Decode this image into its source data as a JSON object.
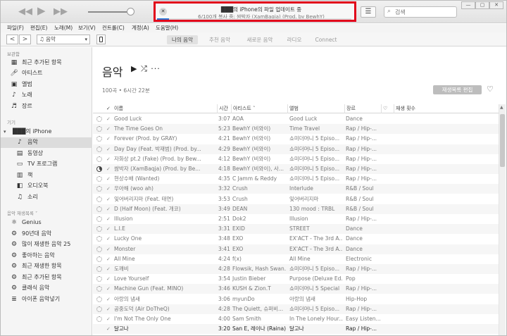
{
  "player": {
    "prev_icon": "rewind-icon",
    "play_icon": "play-icon",
    "next_icon": "fast-forward-icon",
    "volume": 0.88
  },
  "status": {
    "title": "███의 iPhone의 파일 업데이트 중",
    "subtitle": "6/100개 복사 중: 쌈박자 (XamBaqja) (Prod. by BewhY)",
    "close_glyph": "✕",
    "progress": 0.06,
    "highlight_color": "#e1001a"
  },
  "search": {
    "placeholder": "검색",
    "icon": "search-icon"
  },
  "window_controls": [
    "—",
    "▢",
    "✕"
  ],
  "menu": [
    "파일(F)",
    "편집(E)",
    "노래(M)",
    "보기(V)",
    "컨트롤(C)",
    "계정(A)",
    "도움말(H)"
  ],
  "nav": {
    "back": "<",
    "forward": ">",
    "library": "음악",
    "tabs": [
      "나의 음악",
      "추천 음악",
      "새로운 음악",
      "라디오",
      "Connect"
    ],
    "active_tab": "나의 음악"
  },
  "sidebar": {
    "library_header": "보관함",
    "library": [
      {
        "label": "최근 추가된 항목",
        "icon": "recent-grid-icon"
      },
      {
        "label": "아티스트",
        "icon": "microphone-icon"
      },
      {
        "label": "앨범",
        "icon": "album-icon"
      },
      {
        "label": "노래",
        "icon": "note-icon"
      },
      {
        "label": "장르",
        "icon": "genre-icon"
      }
    ],
    "devices_header": "기기",
    "device_name": "███의 iPhone",
    "device_items": [
      {
        "label": "음악",
        "icon": "note-icon"
      },
      {
        "label": "동영상",
        "icon": "film-icon"
      },
      {
        "label": "TV 프로그램",
        "icon": "tv-icon"
      },
      {
        "label": "책",
        "icon": "book-icon"
      },
      {
        "label": "오디오북",
        "icon": "audiobook-icon"
      },
      {
        "label": "소리",
        "icon": "bell-icon"
      }
    ],
    "playlists_header": "음악 재생목록 ˅",
    "playlists": [
      {
        "label": "Genius",
        "icon": "genius-icon"
      },
      {
        "label": "90년대 음악",
        "icon": "gear-icon"
      },
      {
        "label": "많이 재생한 음악 25",
        "icon": "gear-icon"
      },
      {
        "label": "좋아하는 음악",
        "icon": "gear-icon"
      },
      {
        "label": "최근 재생한 항목",
        "icon": "gear-icon"
      },
      {
        "label": "최근 추가된 항목",
        "icon": "gear-icon"
      },
      {
        "label": "클래식 음악",
        "icon": "gear-icon"
      },
      {
        "label": "아이폰 음악넣기",
        "icon": "playlist-icon"
      }
    ]
  },
  "main": {
    "title": "음악",
    "controls": "▶ ⤮ ···",
    "summary": "100곡 • 6시간 22분",
    "edit_button": "재생목록 편집",
    "heart_icon": "heart-icon"
  },
  "table": {
    "headers": {
      "check": "✓",
      "name": "이름",
      "time": "시간",
      "artist": "아티스트",
      "album": "앨범",
      "genre": "장르",
      "love": "♡",
      "plays": "재생 횟수"
    },
    "rows": [
      {
        "name": "Good Luck",
        "time": "3:07",
        "artist": "AOA",
        "album": "Good Luck",
        "genre": "Dance",
        "sync": "done"
      },
      {
        "name": "The Time Goes On",
        "time": "5:23",
        "artist": "BewhY (비와이)",
        "album": "Time Travel",
        "genre": "Rap / Hip-...",
        "sync": "done"
      },
      {
        "name": "Forever (Prod. by GRAY)",
        "time": "4:21",
        "artist": "BewhY (비와이)",
        "album": "쇼미더머니 5 Episo...",
        "genre": "Rap / Hip-...",
        "sync": "done"
      },
      {
        "name": "Day Day (Feat. 박재범) (Prod. by...",
        "time": "4:29",
        "artist": "BewhY (비와이)",
        "album": "쇼미더머니 5 Episo...",
        "genre": "Rap / Hip-...",
        "sync": "done"
      },
      {
        "name": "자화상 pt.2 (Fake) (Prod. by Bew...",
        "time": "4:12",
        "artist": "BewhY (비와이)",
        "album": "쇼미더머니 5 Episo...",
        "genre": "Rap / Hip-...",
        "sync": "done"
      },
      {
        "name": "쌈박자 (XamBaqja) (Prod. by Be...",
        "time": "4:18",
        "artist": "BewhY (비와이), 사...",
        "album": "쇼미더머니 5 Episo...",
        "genre": "Rap / Hip-...",
        "sync": "working"
      },
      {
        "name": "현상수배 (Wanted)",
        "time": "4:35",
        "artist": "C Jamm & Reddy",
        "album": "쇼미더머니 5 Episo...",
        "genre": "Rap / Hip-...",
        "sync": "done"
      },
      {
        "name": "우아해 (woo ah)",
        "time": "3:32",
        "artist": "Crush",
        "album": "Interlude",
        "genre": "R&B / Soul",
        "sync": "done"
      },
      {
        "name": "잊어버리지마 (Feat. 태연)",
        "time": "3:53",
        "artist": "Crush",
        "album": "잊어버리지마",
        "genre": "R&B / Soul",
        "sync": "done"
      },
      {
        "name": "D (Half Moon) (Feat. 개코)",
        "time": "3:49",
        "artist": "DEAN",
        "album": "130 mood : TRBL",
        "genre": "R&B / Soul",
        "sync": "done"
      },
      {
        "name": "Illusion",
        "time": "2:51",
        "artist": "Dok2",
        "album": "Illusion",
        "genre": "Rap / Hip-...",
        "sync": "done"
      },
      {
        "name": "L.I.E",
        "time": "3:31",
        "artist": "EXID",
        "album": "STREET",
        "genre": "Dance",
        "sync": "done"
      },
      {
        "name": "Lucky One",
        "time": "3:48",
        "artist": "EXO",
        "album": "EX'ACT - The 3rd A...",
        "genre": "Dance",
        "sync": "done"
      },
      {
        "name": "Monster",
        "time": "3:41",
        "artist": "EXO",
        "album": "EX'ACT - The 3rd A...",
        "genre": "Dance",
        "sync": "done"
      },
      {
        "name": "All Mine",
        "time": "4:24",
        "artist": "f(x)",
        "album": "All Mine",
        "genre": "Electronic",
        "sync": "done"
      },
      {
        "name": "도깨비",
        "time": "4:28",
        "artist": "Flowsik, Hash Swan...",
        "album": "쇼미더머니 5 Episo...",
        "genre": "Rap / Hip-...",
        "sync": "done"
      },
      {
        "name": "Love Yourself",
        "time": "3:54",
        "artist": "Justin Bieber",
        "album": "Purpose (Deluxe Ed...",
        "genre": "Pop",
        "sync": "done"
      },
      {
        "name": "Machine Gun (Feat. MINO)",
        "time": "3:46",
        "artist": "KUSH & Zion.T",
        "album": "쇼미더머니 5 Special",
        "genre": "Rap / Hip-...",
        "sync": "done"
      },
      {
        "name": "아랑의 냄새",
        "time": "3:06",
        "artist": "myunDo",
        "album": "아랑의 냄새",
        "genre": "Hip-Hop",
        "sync": "done"
      },
      {
        "name": "공중도덕 (Air DoTheQ)",
        "time": "4:28",
        "artist": "The Quiett, 슈퍼비...",
        "album": "쇼미더머니 5 Episo...",
        "genre": "Rap / Hip-...",
        "sync": "done"
      },
      {
        "name": "I'm Not The Only One",
        "time": "4:00",
        "artist": "Sam Smith",
        "album": "In The Lonely Hour...",
        "genre": "Easy Listen...",
        "sync": "done"
      },
      {
        "name": "달고나",
        "time": "3:20",
        "artist": "San E, 레이나 (Raina)",
        "album": "달고나",
        "genre": "Rap / Hip-...",
        "sync": "current"
      }
    ]
  }
}
